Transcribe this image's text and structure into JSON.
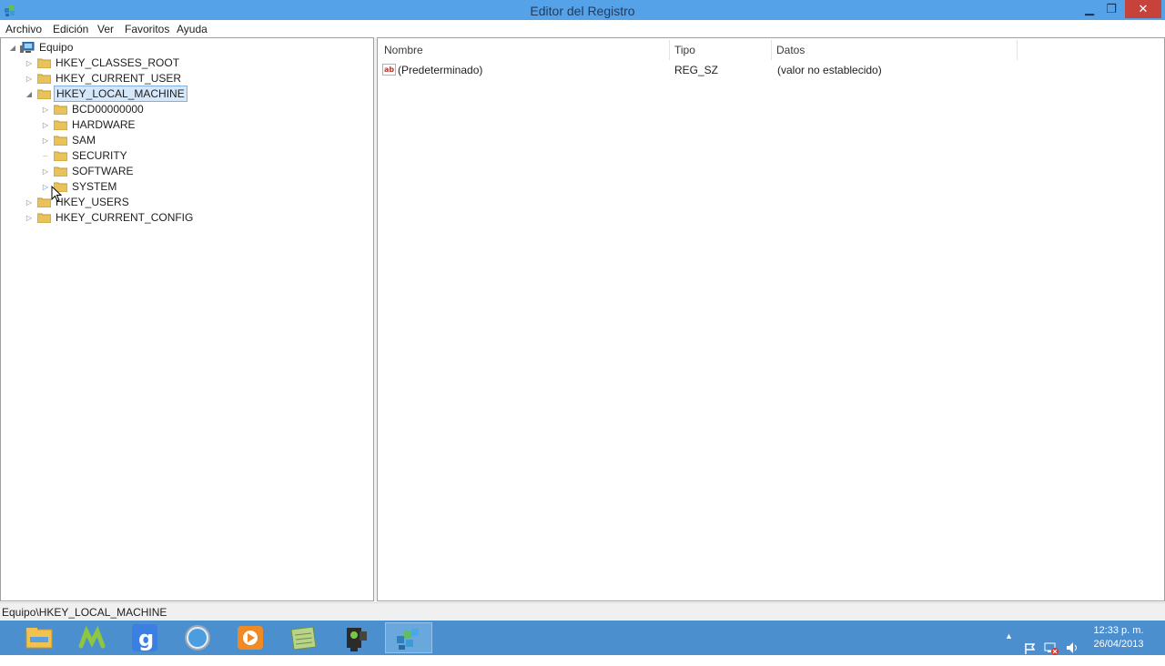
{
  "window": {
    "title": "Editor del Registro",
    "min_glyph": "▁",
    "max_glyph": "❐",
    "close_glyph": "✕"
  },
  "menu": [
    "Archivo",
    "Edición",
    "Ver",
    "Favoritos",
    "Ayuda"
  ],
  "tree": {
    "root": "Equipo",
    "hives": [
      {
        "label": "HKEY_CLASSES_ROOT",
        "expanded": false
      },
      {
        "label": "HKEY_CURRENT_USER",
        "expanded": false
      },
      {
        "label": "HKEY_LOCAL_MACHINE",
        "expanded": true,
        "selected": true,
        "children": [
          "BCD00000000",
          "HARDWARE",
          "SAM",
          "SECURITY",
          "SOFTWARE",
          "SYSTEM"
        ]
      },
      {
        "label": "HKEY_USERS",
        "expanded": false
      },
      {
        "label": "HKEY_CURRENT_CONFIG",
        "expanded": false
      }
    ]
  },
  "list": {
    "columns": [
      "Nombre",
      "Tipo",
      "Datos"
    ],
    "rows": [
      {
        "name": "(Predeterminado)",
        "type": "REG_SZ",
        "data": "(valor no establecido)"
      }
    ]
  },
  "status": "Equipo\\HKEY_LOCAL_MACHINE",
  "taskbar": {
    "apps": [
      "file-explorer",
      "movistar",
      "google",
      "safari",
      "media-player",
      "notes",
      "camera-app",
      "registry-editor"
    ],
    "clock_time": "12:33 p. m.",
    "clock_date": "26/04/2013"
  },
  "colors": {
    "titlebar": "#55a2e8",
    "taskbar": "#4b8fcf",
    "selection": "#d5e8fb",
    "folder": "#e8c25a"
  }
}
